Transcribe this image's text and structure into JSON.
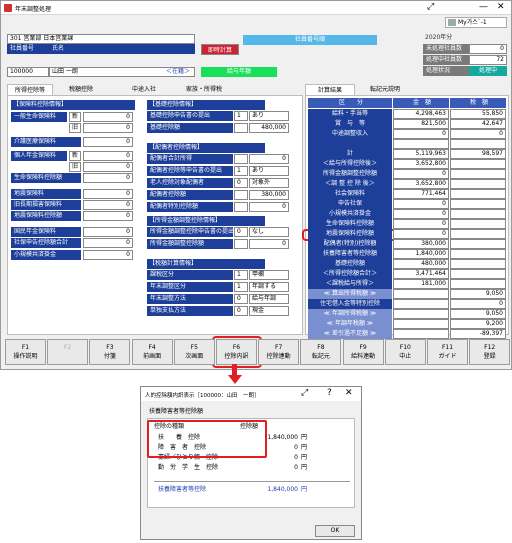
{
  "window": {
    "title": "年末調整処理",
    "user": "My가스`-1"
  },
  "header": {
    "row1_code": "301 営業部 日本営業課",
    "shain_bango_label": "社員番号",
    "shimei_label": "氏名",
    "sokuji_keisan": "即時計算",
    "shain_bango_label2": "社員番号順",
    "kyuyo_nengaku": "給与年額",
    "employee_no": "100000",
    "employee_name": "山田 一朗",
    "shinki": "＜在籍＞",
    "year": "2020年分",
    "right_rows": [
      {
        "label": "未処理社員数",
        "value": "0"
      },
      {
        "label": "処理中社員数",
        "value": "72"
      },
      {
        "label": "処理状況",
        "value": "処理中"
      }
    ]
  },
  "tabs": [
    "所得控除等",
    "税額控除",
    "中途入社",
    "家族・所得税",
    "計算結果",
    "転記元説明"
  ],
  "insurance": {
    "title": "【保険料控除情報】",
    "rows": [
      {
        "label": "一般生命保険料",
        "sub": "新",
        "value": "0"
      },
      {
        "label": "",
        "sub": "旧",
        "value": "0"
      },
      {
        "label": "介護医療保険料",
        "sub": "",
        "value": "0"
      },
      {
        "label": "個人年金保険料",
        "sub": "新",
        "value": "0"
      },
      {
        "label": "",
        "sub": "旧",
        "value": "0"
      },
      {
        "label": "生命保険料控除額",
        "sub": "",
        "value": "0"
      },
      {
        "label": "地震保険料",
        "sub": "",
        "value": "0"
      },
      {
        "label": "旧長期損害保険料",
        "sub": "",
        "value": "0"
      },
      {
        "label": "地震保険料控除額",
        "sub": "",
        "value": "0"
      },
      {
        "label": "国民年金保険料",
        "sub": "",
        "value": "0"
      },
      {
        "label": "社保申告控除額合計",
        "sub": "",
        "value": "0"
      },
      {
        "label": "小規模共済掛金",
        "sub": "",
        "value": "0"
      }
    ]
  },
  "basic": {
    "title": "【基礎控除情報】",
    "rows": [
      {
        "label": "基礎控除申告書の提出",
        "code": "1",
        "value": "あり"
      },
      {
        "label": "基礎控除額",
        "code": "",
        "value": "480,000"
      }
    ]
  },
  "spouse": {
    "title": "【配偶者控除情報】",
    "rows": [
      {
        "label": "配偶者合計所得",
        "code": "",
        "value": "0"
      },
      {
        "label": "配偶者控除等申告書の提出",
        "code": "1",
        "value": "あり"
      },
      {
        "label": "老人控除対象配偶者",
        "code": "0",
        "value": "対象外"
      },
      {
        "label": "配偶者控除額",
        "code": "",
        "value": "380,000"
      },
      {
        "label": "配偶者特別控除額",
        "code": "",
        "value": "0"
      }
    ]
  },
  "adjust": {
    "title": "【所得金額調整控除情報】",
    "rows": [
      {
        "label": "所得金額調整控除申告書の提出",
        "code": "0",
        "value": "なし"
      },
      {
        "label": "所得金額調整控除額",
        "code": "",
        "value": "0"
      }
    ]
  },
  "tax": {
    "title": "【税額計算情報】",
    "rows": [
      {
        "label": "課税区分",
        "code": "1",
        "value": "甲欄"
      },
      {
        "label": "年末調整区分",
        "code": "1",
        "value": "年調する"
      },
      {
        "label": "年末調整方法",
        "code": "0",
        "value": "給与年調"
      },
      {
        "label": "単独支払方法",
        "code": "0",
        "value": "現金"
      }
    ]
  },
  "result": {
    "headers": [
      "区　　分",
      "金　額",
      "税　額"
    ],
    "rows": [
      {
        "label": "給料・手当等",
        "amount": "4,298,463",
        "tax": "55,850"
      },
      {
        "label": "賞　与　等",
        "amount": "821,500",
        "tax": "42,647"
      },
      {
        "label": "中途調整収入",
        "amount": "0",
        "tax": "0"
      },
      {
        "label": "",
        "amount": "",
        "tax": ""
      },
      {
        "label": "計",
        "amount": "5,119,963",
        "tax": "98,597"
      },
      {
        "label": "＜給与所得控除後＞",
        "amount": "3,652,800",
        "tax": ""
      },
      {
        "label": "所得金額調整控除額",
        "amount": "0",
        "tax": ""
      },
      {
        "label": "＜調 整 控 除 後＞",
        "amount": "3,652,800",
        "tax": ""
      },
      {
        "label": "社会保険料",
        "amount": "771,464",
        "tax": ""
      },
      {
        "label": "申告社保",
        "amount": "0",
        "tax": ""
      },
      {
        "label": "小規模共済掛金",
        "amount": "0",
        "tax": ""
      },
      {
        "label": "生命保険料控除額",
        "amount": "0",
        "tax": ""
      },
      {
        "label": "地震保険料控除額",
        "amount": "0",
        "tax": ""
      },
      {
        "label": "配偶者(特別)控除額",
        "amount": "380,000",
        "tax": ""
      },
      {
        "label": "扶養障害者等控除額",
        "amount": "1,840,000",
        "tax": ""
      },
      {
        "label": "基礎控除額",
        "amount": "480,000",
        "tax": ""
      },
      {
        "label": "＜所得控除額合計＞",
        "amount": "3,471,464",
        "tax": ""
      },
      {
        "label": "＜課税給与所得＞",
        "amount": "181,000",
        "tax": ""
      },
      {
        "label": "≪ 算出所得税額 ≫",
        "amount": "",
        "tax": "9,050"
      },
      {
        "label": "住宅借入金等特別控除",
        "amount": "",
        "tax": "0"
      },
      {
        "label": "≪ 年調所得税額 ≫",
        "amount": "",
        "tax": "9,050"
      },
      {
        "label": "≪ 年調年税額 ≫",
        "amount": "",
        "tax": "9,200"
      },
      {
        "label": "≪ 差引過不足額 ≫",
        "amount": "",
        "tax": "-89,397"
      }
    ]
  },
  "fkeys": [
    {
      "key": "F1",
      "label": "操作説明",
      "disabled": false
    },
    {
      "key": "F2",
      "label": "",
      "disabled": true
    },
    {
      "key": "F3",
      "label": "付箋",
      "disabled": false
    },
    {
      "key": "F4",
      "label": "前画面",
      "disabled": false
    },
    {
      "key": "F5",
      "label": "次画面",
      "disabled": false
    },
    {
      "key": "F6",
      "label": "控除内訳",
      "disabled": false
    },
    {
      "key": "F7",
      "label": "控除連動",
      "disabled": false
    },
    {
      "key": "F8",
      "label": "転記元",
      "disabled": false
    },
    {
      "key": "F9",
      "label": "給料連動",
      "disabled": false
    },
    {
      "key": "F10",
      "label": "中止",
      "disabled": false
    },
    {
      "key": "F11",
      "label": "ガイド",
      "disabled": false
    },
    {
      "key": "F12",
      "label": "登録",
      "disabled": false
    }
  ],
  "dialog": {
    "title": "人的控除額内訳表示［100000：山田　一朗］",
    "section": "扶養障害者等控除額",
    "col1": "控除の種類",
    "col2": "控除額",
    "rows": [
      {
        "label": "扶　　養　控除",
        "value": "1,840,000",
        "unit": "円"
      },
      {
        "label": "障　害　者　控除",
        "value": "0",
        "unit": "円"
      },
      {
        "label": "寡婦／ひとり親　控除",
        "value": "0",
        "unit": "円"
      },
      {
        "label": "勤　労　学　生　控除",
        "value": "0",
        "unit": "円"
      }
    ],
    "total_label": "扶養障害者等控除",
    "total_value": "1,840,000",
    "total_unit": "円",
    "ok": "OK"
  }
}
